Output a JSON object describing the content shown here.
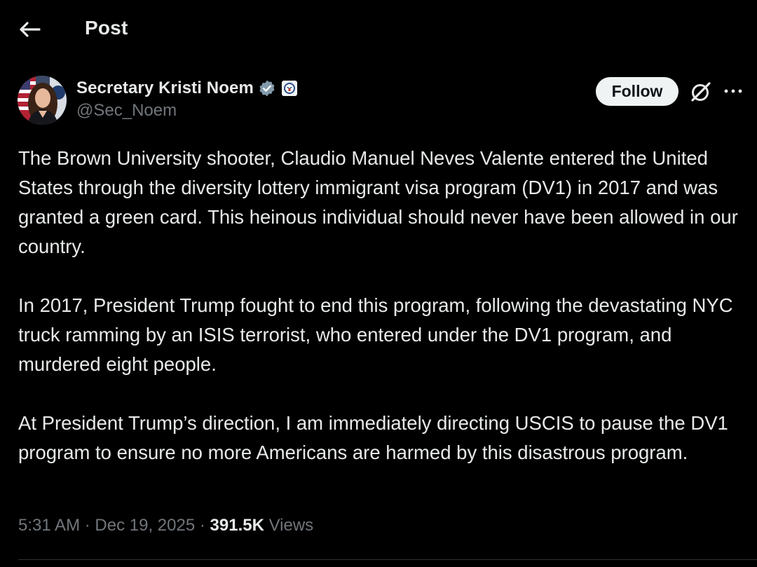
{
  "header": {
    "title": "Post",
    "back_icon": "arrow-left-icon"
  },
  "author": {
    "name": "Secretary Kristi Noem",
    "handle": "@Sec_Noem",
    "verified_icon": "verified-badge-icon",
    "affiliation_icon": "dhs-seal-icon",
    "avatar_icon": "profile-photo"
  },
  "actions": {
    "follow_label": "Follow",
    "grok_icon": "grok-icon",
    "more_icon": "more-dots-icon"
  },
  "post": {
    "paragraphs": [
      "The Brown University shooter, Claudio Manuel Neves Valente entered the United States through the diversity lottery immigrant visa program (DV1) in 2017 and was granted a green card. This heinous individual should never have been allowed in our country.",
      "In 2017, President Trump fought to end this program, following the devastating NYC truck ramming by an ISIS terrorist, who entered under the DV1 program, and murdered eight people.",
      "At President Trump’s direction, I am immediately directing USCIS to pause the DV1 program to ensure no more Americans are harmed by this disastrous program."
    ]
  },
  "meta": {
    "time": "5:31 AM",
    "separator": "·",
    "date": "Dec 19, 2025",
    "views_count": "391.5K",
    "views_label": "Views"
  },
  "colors": {
    "background": "#000000",
    "text_primary": "#e7e9ea",
    "text_secondary": "#71767b",
    "verified_badge": "#829aab",
    "follow_bg": "#eff3f4"
  }
}
